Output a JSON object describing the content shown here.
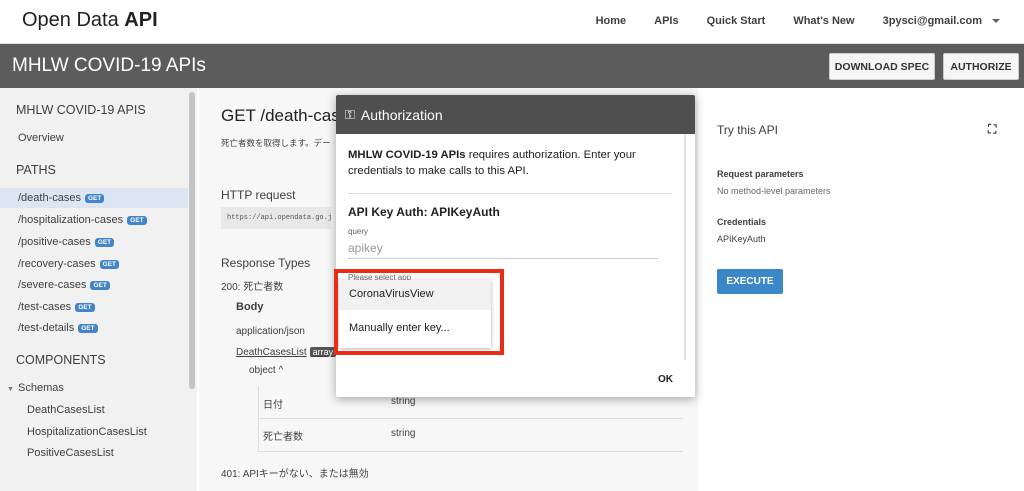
{
  "brand": {
    "prefix": "Open Data ",
    "bold": "API"
  },
  "topnav": {
    "home": "Home",
    "apis": "APIs",
    "quickstart": "Quick Start",
    "whatsnew": "What's New",
    "user": "3pysci@gmail.com"
  },
  "apibar": {
    "title": "MHLW COVID-19 APIs",
    "download": "DOWNLOAD SPEC",
    "authorize": "AUTHORIZE"
  },
  "sidebar": {
    "heading": "MHLW COVID-19 APIS",
    "overview": "Overview",
    "paths_label": "PATHS",
    "paths": [
      {
        "label": "/death-cases",
        "badge": "GET"
      },
      {
        "label": "/hospitalization-cases",
        "badge": "GET"
      },
      {
        "label": "/positive-cases",
        "badge": "GET"
      },
      {
        "label": "/recovery-cases",
        "badge": "GET"
      },
      {
        "label": "/severe-cases",
        "badge": "GET"
      },
      {
        "label": "/test-cases",
        "badge": "GET"
      },
      {
        "label": "/test-details",
        "badge": "GET"
      }
    ],
    "components_label": "COMPONENTS",
    "schemas_label": "Schemas",
    "schemas": [
      "DeathCasesList",
      "HospitalizationCasesList",
      "PositiveCasesList"
    ]
  },
  "main": {
    "title": "GET /death-cas",
    "desc": "死亡者数を取得します。デー",
    "http_label": "HTTP request",
    "http_url": "https://api.opendata.go.jp",
    "resp_label": "Response Types",
    "resp200": "200: 死亡者数",
    "body": "Body",
    "ctype": "application/json",
    "list_link": "DeathCasesList",
    "array": "array",
    "object": "object ^",
    "rows": [
      {
        "k": "日付",
        "v": "string"
      },
      {
        "k": "死亡者数",
        "v": "string"
      }
    ],
    "resp401": "401: APIキーがない、または無効"
  },
  "right": {
    "try": "Try this API",
    "req_params": "Request parameters",
    "no_params": "No method-level parameters",
    "credentials": "Credentials",
    "cred_value": "APIKeyAuth",
    "execute": "EXECUTE"
  },
  "dialog": {
    "title": "Authorization",
    "desc_bold": "MHLW COVID-19 APIs",
    "desc_rest": " requires authorization. Enter your credentials to make calls to this API.",
    "auth_name": "API Key Auth: APIKeyAuth",
    "query_label": "query",
    "placeholder": "apikey",
    "select_label": "Please select app",
    "ok": "OK"
  },
  "dropdown": {
    "options": [
      "CoronaVirusView",
      "Manually enter key..."
    ]
  }
}
